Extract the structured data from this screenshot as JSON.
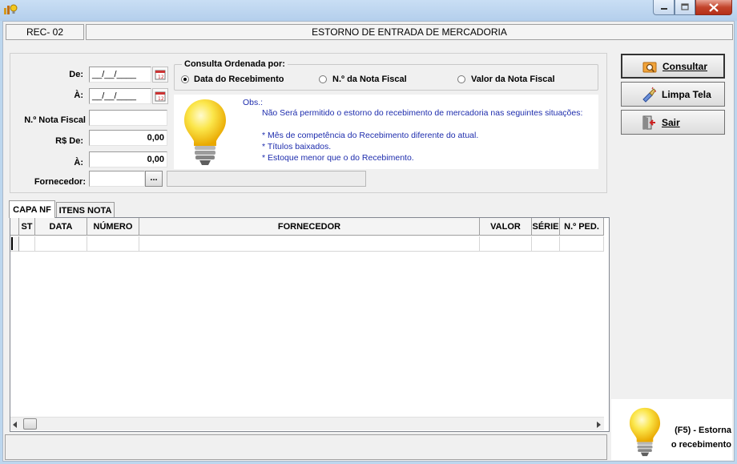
{
  "header": {
    "code": "REC- 02",
    "title": "ESTORNO DE ENTRADA DE MERCADORIA"
  },
  "filters": {
    "de_label": "De:",
    "de_value": "__/__/____",
    "a_label": "À:",
    "a_value": "__/__/____",
    "nota_label": "N.º Nota Fiscal",
    "nota_value": "",
    "valor_de_label": "R$ De:",
    "valor_de_value": "0,00",
    "valor_a_label": "À:",
    "valor_a_value": "0,00",
    "fornecedor_label": "Fornecedor:",
    "fornecedor_code": "",
    "fornecedor_btn": "...",
    "fornecedor_name": ""
  },
  "order": {
    "legend": "Consulta Ordenada por:",
    "options": [
      {
        "label": "Data do Recebimento",
        "selected": true
      },
      {
        "label": "N.º da Nota Fiscal",
        "selected": false
      },
      {
        "label": "Valor da Nota Fiscal",
        "selected": false
      }
    ]
  },
  "obs": {
    "title": "Obs.:",
    "lines": [
      "Não Será permitido o estorno do recebimento de mercadoria  nas seguintes situações:",
      "* Mês de competência do Recebimento diferente do atual.",
      "* Títulos baixados.",
      "* Estoque menor que o do Recebimento."
    ]
  },
  "buttons": {
    "consultar": "Consultar",
    "limpa": "Limpa Tela",
    "sair": "Sair"
  },
  "tabs": [
    "CAPA NF",
    "ITENS NOTA"
  ],
  "grid": {
    "columns": [
      "ST",
      "DATA",
      "NÚMERO",
      "FORNECEDOR",
      "VALOR",
      "SÉRIE",
      "N.º PED."
    ]
  },
  "hint": {
    "line1": "(F5) - Estorna",
    "line2": "o recebimento"
  },
  "colors": {
    "obs_text": "#1e2dad",
    "window_frame": "#bcd6ee",
    "close_red": "#c3442c"
  }
}
